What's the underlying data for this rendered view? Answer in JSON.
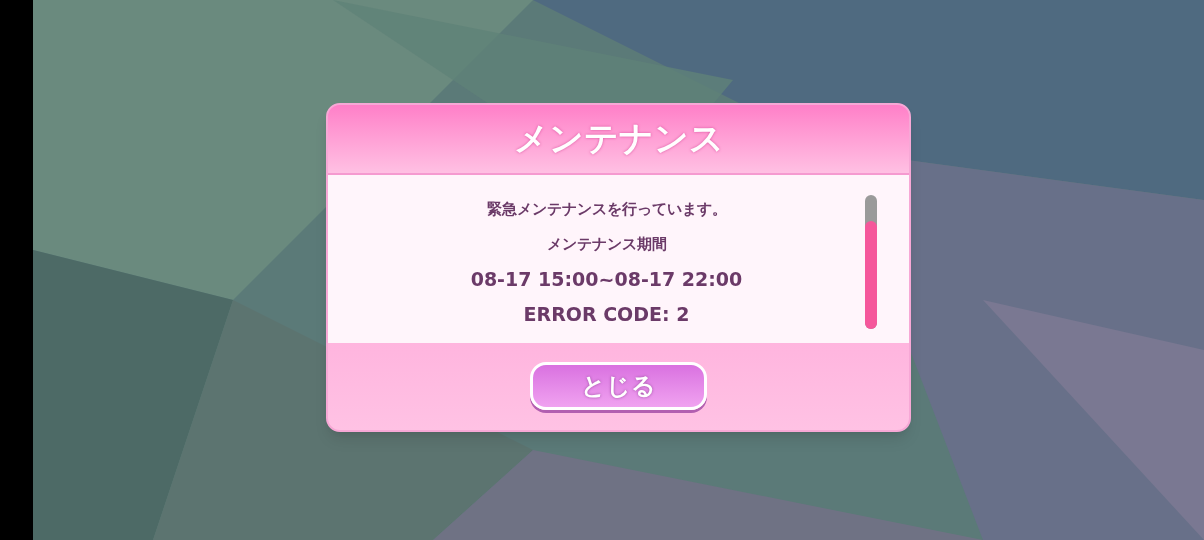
{
  "dialog": {
    "title": "メンテナンス",
    "lines": [
      "緊急メンテナンスを行っています。",
      "メンテナンス期間",
      "08-17 15:00~08-17 22:00",
      "ERROR CODE: 2"
    ],
    "button": "とじる"
  }
}
